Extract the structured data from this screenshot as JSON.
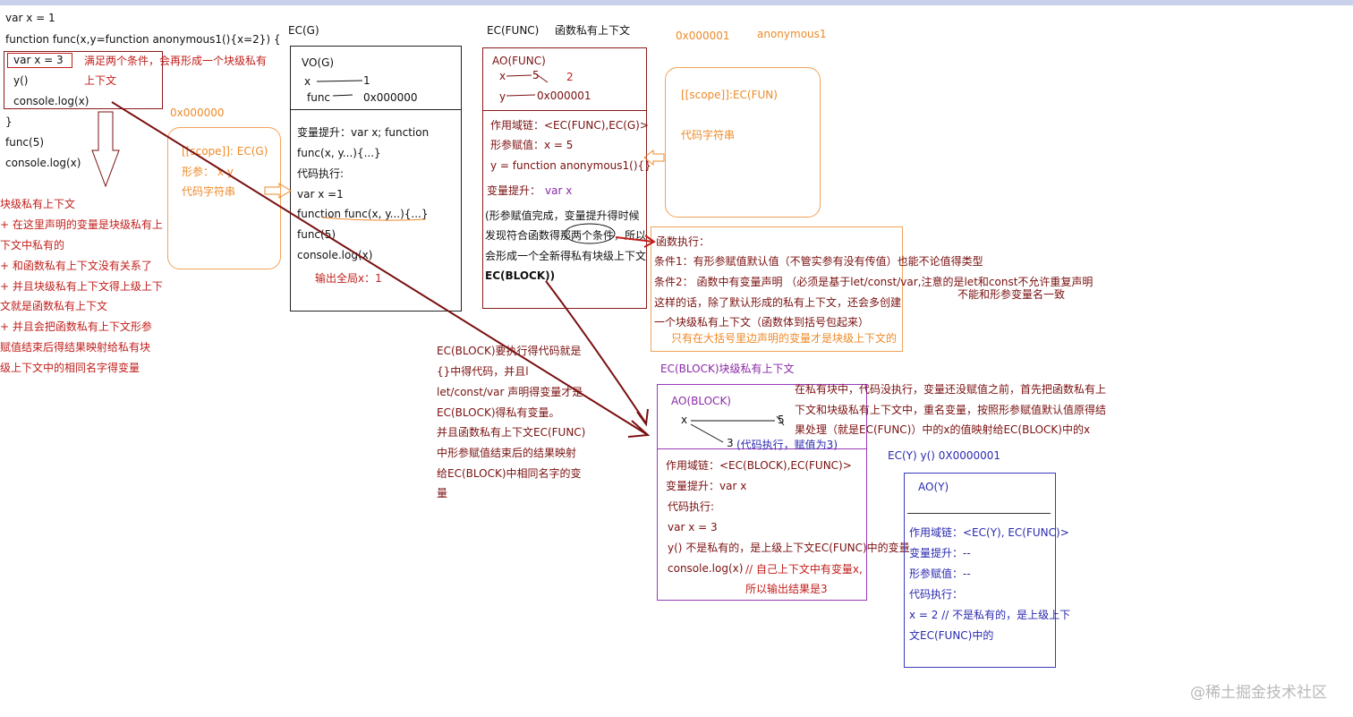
{
  "code": {
    "l1": "var x = 1",
    "l2": "function func(x,y=function anonymous1(){x=2}) {",
    "l3": "var x = 3",
    "l4": "y()",
    "l5": "console.log(x)",
    "l6": "}",
    "l7": "func(5)",
    "l8": "console.log(x)",
    "note_a": "满足两个条件，会再形成一个块级私有",
    "note_b": "上下文"
  },
  "addr_left": "0x000000",
  "left_notes": {
    "title": "块级私有上下文",
    "l1": "+ 在这里声明的变量是块级私有上",
    "l2": "下文中私有的",
    "l3": "+ 和函数私有上下文没有关系了",
    "l4": "+ 并且块级私有上下文得上级上下",
    "l5": "文就是函数私有上下文",
    "l6": "+ 并且会把函数私有上下文形参",
    "l7": "赋值结束后得结果映射给私有块",
    "l8": "级上下文中的相同名字得变量"
  },
  "heap_func": {
    "scope": "[[scope]]: EC(G)",
    "params": "形参：  x   y",
    "code": "代码字符串"
  },
  "ecg": {
    "title": "EC(G)",
    "vo": "VO(G)",
    "x": "x",
    "x_val": "1",
    "func": "func",
    "func_val": "0x000000",
    "l1": "变量提升：var x; function",
    "l2": "func(x, y...){...}",
    "l3": "代码执行:",
    "l4": "var x =1",
    "l5": "function func(x, y...){...}",
    "l6": "func(5)",
    "l7": "console.log(x)",
    "l8": "输出全局x：1"
  },
  "ecfunc": {
    "title": "EC(FUNC)",
    "subtitle": "函数私有上下文",
    "ao": "AO(FUNC)",
    "x": "x",
    "x_old": "5",
    "x_new": "2",
    "y": "y",
    "y_val": "0x000001",
    "l1": "作用域链：<EC(FUNC),EC(G)>",
    "l2": "形参赋值：x = 5",
    "l3": "y = function anonymous1(){}",
    "l4a": "变量提升：",
    "l4b": "var x",
    "l5": "(形参赋值完成，变量提升得时候",
    "l6": "发现符合函数得那两个条件，所以",
    "l7": "会形成一个全新得私有块级上下文",
    "l8": "EC(BLOCK))"
  },
  "anon": {
    "addr": "0x000001",
    "name": "anonymous1",
    "scope": "[[scope]]:EC(FUN)",
    "code": "代码字符串"
  },
  "cond": {
    "l1": "函数执行：",
    "l2": "条件1：有形参赋值默认值（不管实参有没有传值）也能不论值得类型",
    "l3": "条件2：  函数中有变量声明  （必须是基于let/const/var,注意的是let和const不允许重复声明",
    "l3b": "不能和形参变量名一致",
    "l4": "这样的话，除了默认形成的私有上下文，还会多创建",
    "l5": "一个块级私有上下文（函数体到括号包起来）",
    "l6": "只有在大括号里边声明的变量才是块级上下文的"
  },
  "mid_notes": {
    "l1": "EC(BLOCK)要执行得代码就是",
    "l2": "{}中得代码，并且l",
    "l3": "let/const/var 声明得变量才是",
    "l4": "EC(BLOCK)得私有变量。",
    "l5": "并且函数私有上下文EC(FUNC)",
    "l6": "中形参赋值结束后的结果映射",
    "l7": "给EC(BLOCK)中相同名字的变",
    "l8": "量"
  },
  "ecblock": {
    "title": "EC(BLOCK)块级私有上下文",
    "ao": "AO(BLOCK)",
    "x": "x",
    "x_old": "5",
    "x_new": "3",
    "x_note": "(代码执行，赋值为3)",
    "l1": "作用域链：<EC(BLOCK),EC(FUNC)>",
    "l2": "变量提升：var x",
    "l3": "代码执行:",
    "l4": "var x = 3",
    "l5": "y() 不是私有的，是上级上下文EC(FUNC)中的变量",
    "l6": "console.log(x)",
    "l6b": "// 自己上下文中有变量x,",
    "l7": "所以输出结果是3"
  },
  "block_note": {
    "l1": "在私有块中，代码没执行，变量还没赋值之前，首先把函数私有上",
    "l2": "下文和块级私有上下文中，重名变量，按照形参赋值默认值原得结",
    "l3": "果处理（就是EC(FUNC)）中的x的值映射给EC(BLOCK)中的x"
  },
  "ecy": {
    "title": "EC(Y)  y()   0X0000001",
    "ao": "AO(Y)",
    "l1": "作用域链：<EC(Y), EC(FUNC)>",
    "l2": "变量提升：--",
    "l3": "形参赋值：--",
    "l4": "代码执行：",
    "l5": "x = 2  // 不是私有的，是上级上下",
    "l6": "文EC(FUNC)中的"
  },
  "watermark": "@稀土掘金技术社区",
  "colors": {
    "red": "#c0201c",
    "dark_red": "#7a1010",
    "orange": "#ee8a28",
    "purple": "#8a2aa8",
    "blue": "#2a2ab0"
  }
}
